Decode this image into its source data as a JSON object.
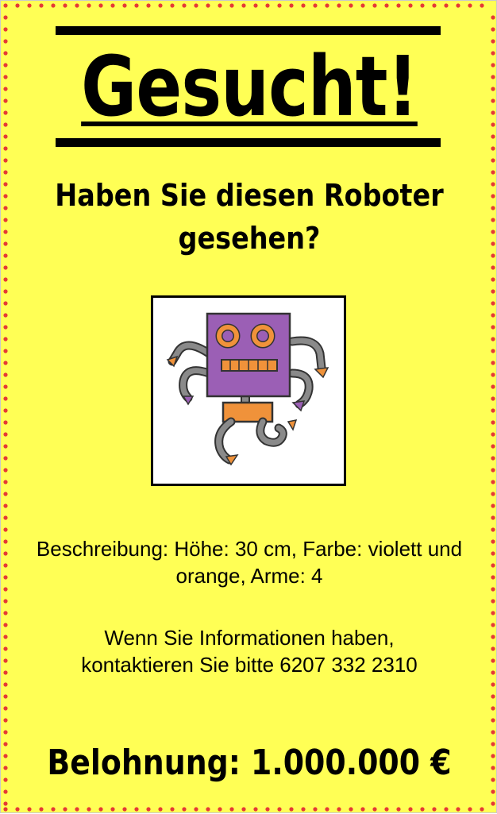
{
  "poster": {
    "title": "Gesucht!",
    "subtitle_line1": "Haben Sie diesen Roboter",
    "subtitle_line2": "gesehen?",
    "description": "Beschreibung: Höhe: 30 cm, Farbe: violett und orange, Arme: 4",
    "contact": "Wenn Sie Informationen haben, kontaktieren Sie bitte 6207 332 2310",
    "reward": "Belohnung: 1.000.000 €"
  },
  "colors": {
    "background": "#ffff55",
    "dot_border": "#e53935",
    "robot_body": "#9b5fb5",
    "robot_accent": "#f0923a",
    "robot_limbs": "#8a8a8a"
  }
}
